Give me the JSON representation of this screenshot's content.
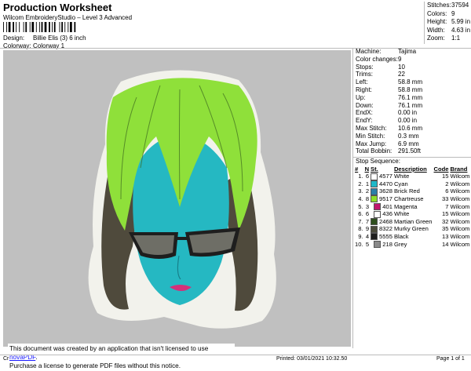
{
  "header": {
    "title": "Production Worksheet",
    "app": "Wilcom EmbroideryStudio – Level 3 Advanced",
    "design_label": "Design:",
    "design_value": "Billie Elis (3) 6 inch",
    "colorway_label": "Colorway:",
    "colorway_value": "Colorway 1"
  },
  "stats": [
    {
      "k": "Stitches:",
      "v": "37594"
    },
    {
      "k": "Colors:",
      "v": "9"
    },
    {
      "k": "Height:",
      "v": "5.99 in"
    },
    {
      "k": "Width:",
      "v": "4.63 in"
    },
    {
      "k": "Zoom:",
      "v": "1:1"
    }
  ],
  "props": [
    {
      "k": "Machine:",
      "v": "Tajima"
    },
    {
      "k": "Color changes:",
      "v": "9"
    },
    {
      "k": "Stops:",
      "v": "10"
    },
    {
      "k": "Trims:",
      "v": "22"
    },
    {
      "k": "Left:",
      "v": "58.8 mm"
    },
    {
      "k": "Right:",
      "v": "58.8 mm"
    },
    {
      "k": "Up:",
      "v": "76.1 mm"
    },
    {
      "k": "Down:",
      "v": "76.1 mm"
    },
    {
      "k": "EndX:",
      "v": "0.00 in"
    },
    {
      "k": "EndY:",
      "v": "0.00 in"
    },
    {
      "k": "Max Stitch:",
      "v": "10.6 mm"
    },
    {
      "k": "Min Stitch:",
      "v": "0.3 mm"
    },
    {
      "k": "Max Jump:",
      "v": "6.9 mm"
    },
    {
      "k": "Total Bobbin:",
      "v": "291.50ft"
    }
  ],
  "stop_sequence": {
    "label": "Stop Sequence:",
    "headers": [
      "#",
      "N",
      "St.",
      "Description",
      "Code",
      "Brand"
    ],
    "rows": [
      {
        "n": "1.",
        "N": "6",
        "color": "#ffffff",
        "st": "4577",
        "desc": "White",
        "code": "15",
        "brand": "Wilcom"
      },
      {
        "n": "2.",
        "N": "1",
        "color": "#1fb8c8",
        "st": "4470",
        "desc": "Cyan",
        "code": "2",
        "brand": "Wilcom"
      },
      {
        "n": "3.",
        "N": "2",
        "color": "#2a7fa8",
        "st": "3628",
        "desc": "Brick Red",
        "code": "6",
        "brand": "Wilcom"
      },
      {
        "n": "4.",
        "N": "8",
        "color": "#8cde2a",
        "st": "9517",
        "desc": "Chartreuse",
        "code": "33",
        "brand": "Wilcom"
      },
      {
        "n": "5.",
        "N": "3",
        "color": "#c0156e",
        "st": "401",
        "desc": "Magenta",
        "code": "7",
        "brand": "Wilcom"
      },
      {
        "n": "6.",
        "N": "6",
        "color": "#ffffff",
        "st": "436",
        "desc": "White",
        "code": "15",
        "brand": "Wilcom"
      },
      {
        "n": "7.",
        "N": "7",
        "color": "#2f4f1e",
        "st": "2468",
        "desc": "Martian Green",
        "code": "32",
        "brand": "Wilcom"
      },
      {
        "n": "8.",
        "N": "9",
        "color": "#4a4a3a",
        "st": "8322",
        "desc": "Murky Green",
        "code": "35",
        "brand": "Wilcom"
      },
      {
        "n": "9.",
        "N": "4",
        "color": "#1e1e1e",
        "st": "5555",
        "desc": "Black",
        "code": "13",
        "brand": "Wilcom"
      },
      {
        "n": "10.",
        "N": "5",
        "color": "#8a8a8a",
        "st": "218",
        "desc": "Grey",
        "code": "14",
        "brand": "Wilcom"
      }
    ]
  },
  "notice": {
    "line1": "This document was created by an application that isn't licensed to use ",
    "link": "novaPDF",
    "line1_end": ".",
    "line2": "Purchase a license to generate PDF files without this notice."
  },
  "footer": {
    "left": "Cr",
    "printed": "Printed: 03/01/2021 10:32.50",
    "page": "Page 1 of 1"
  },
  "colors": {
    "hair": "#8fe03a",
    "hair_dark": "#4f4a3c",
    "skin": "#25b8c2",
    "lips": "#d4307a",
    "glasses": "#1e1e1e",
    "lens": "#6e6e66",
    "background": "#c0c0c0"
  }
}
